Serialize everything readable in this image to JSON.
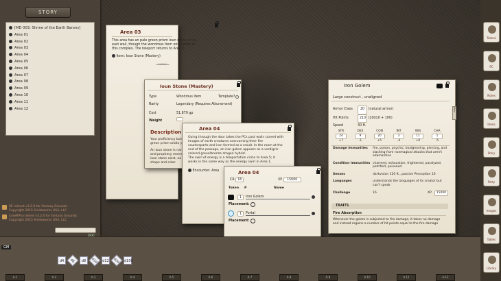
{
  "story": {
    "tab_label": "STORY",
    "items": [
      "[MD 003: Shrine of the Earth Barons]",
      "Area 01",
      "Area 02",
      "Area 03",
      "Area 04",
      "Area 05",
      "Area 06",
      "Area 07",
      "Area 08",
      "Area 09",
      "Area 10",
      "Area 11",
      "Area 12"
    ],
    "modules": [
      "5E ruleset v3.2.0 for Fantasy Grounds\nCopyright 2015 Smiteworks USA, LLC",
      "CoreRPG ruleset v3.2.0 for Fantasy Grounds\nCopyright 2015 Smiteworks USA, LLC"
    ],
    "footer_label": "OOC"
  },
  "area03": {
    "title": "Area 03",
    "text": "This area has an pale green prism ioun stone on its east wall, though the wondrous item only works in this complex. The teleport returns to Area 2.",
    "link": "Item: Ioun Stone (Mastery)"
  },
  "ioun": {
    "title": "Ioun Stone (Mastery)",
    "type_label": "Type",
    "type_value": "Wondrous Item",
    "template_label": "Template?",
    "rarity_label": "Rarity",
    "rarity_value": "Legendary (Requires Attunement)",
    "cost_label": "Cost",
    "cost_value": "51,879 gp",
    "weight_label": "Weight",
    "desc_heading": "Description",
    "desc_p1": "Your proficiency bon green prism orbits y",
    "desc_p2": "An ioun stone is nam and prophecy revere ioun stone exist, ea shape and color."
  },
  "area04_story": {
    "title": "Area 04",
    "p1": "Going through the door takes the PCs past walls carved with images of earth creatures overcoming their fire counterparts and iron formed as a result. In the room at the end of the passage, an iron golem appears as a verdigris-colored green/bronze dragon hybrid.",
    "p2": "The swirl of energy is a teleportation circle to Area 5; it works in the same way as the energy swirl in Area 1.",
    "link": "Encounter: Area"
  },
  "encounter": {
    "title": "Area 04",
    "cr_label": "CR",
    "cr_value": "16",
    "xp_label": "XP",
    "xp_value": "15000",
    "col_token": "Token",
    "col_num": "#",
    "col_name": "Name",
    "rows": [
      {
        "count": "1",
        "name": "Iron Golem",
        "placement": "Placement:"
      },
      {
        "count": "1",
        "name": "Portal",
        "placement": "Placement:"
      }
    ]
  },
  "golem": {
    "title": "Iron Golem",
    "subtitle": "Large construct , unaligned",
    "ac_label": "Armor Class",
    "ac_value": "20",
    "ac_note": "(natural armor)",
    "hp_label": "Hit Points",
    "hp_value": "210",
    "hp_note": "(20d10 + 100)",
    "speed_label": "Speed",
    "speed_value": "30 ft.",
    "abilities": [
      {
        "name": "STR",
        "score": "24",
        "mod": "+7"
      },
      {
        "name": "DEX",
        "score": "9",
        "mod": "-1"
      },
      {
        "name": "CON",
        "score": "20",
        "mod": "+5"
      },
      {
        "name": "INT",
        "score": "3",
        "mod": "-4"
      },
      {
        "name": "WIS",
        "score": "11",
        "mod": "+0"
      },
      {
        "name": "CHA",
        "score": "1",
        "mod": "-5"
      }
    ],
    "dmg_imm_label": "Damage Immunities",
    "dmg_imm_value": "fire, poison, psychic; bludgeoning, piercing, and slashing from nonmagical attacks that aren't adamantine",
    "cond_imm_label": "Condition Immunities",
    "cond_imm_value": "charmed, exhaustion, frightened, paralyzed, petrified, poisoned",
    "senses_label": "Senses",
    "senses_value": "darkvision 120 ft., passive Perception 10",
    "lang_label": "Languages",
    "lang_value": "understands the languages of its creator but can't speak",
    "chal_label": "Challenge",
    "chal_value": "16",
    "xp_label": "XP",
    "xp_value": "15000",
    "traits_heading": "TRAITS",
    "trait_name": "Fire Absorption",
    "trait_text": "Whenever the golem is subjected to fire damage, it takes no damage and instead regains a number of hit points equal to the fire damage",
    "side_tab": "Main"
  },
  "chat": {
    "gm_label": "GM",
    "dice": [
      "d4",
      "d6",
      "d8",
      "d10",
      "d12",
      "d20",
      "d100"
    ],
    "bottom_tabs": [
      "A-1",
      "A-2",
      "A-3",
      "A-4",
      "A-5",
      "A-6",
      "A-7",
      "A-8",
      "A-9",
      "A-10",
      "A-11",
      "A-12"
    ]
  },
  "toolbar": {
    "buttons": [
      "Tokens",
      "PC",
      "Notes",
      "Items",
      "Story",
      "Party",
      "Images",
      "Tables",
      "Library"
    ]
  }
}
